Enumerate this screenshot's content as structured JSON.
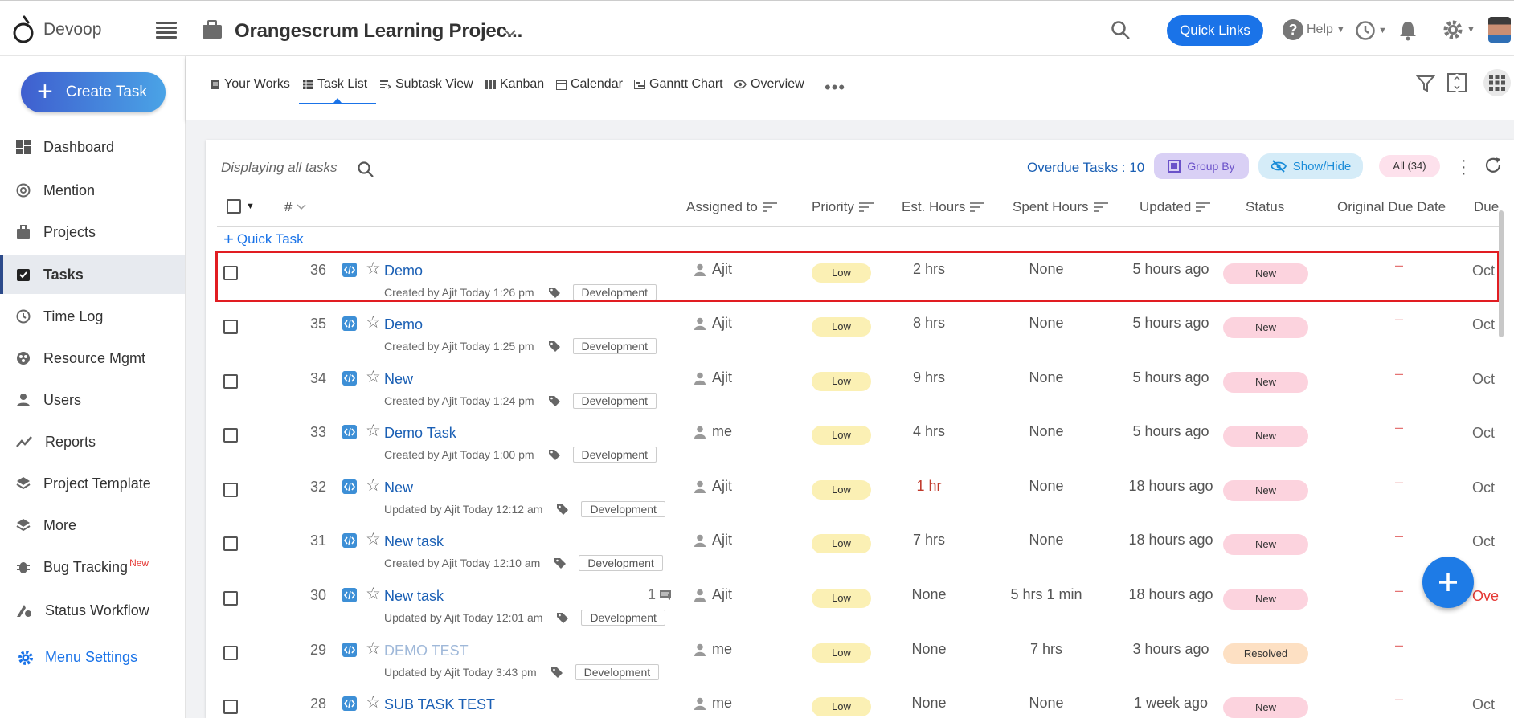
{
  "topbar": {
    "brand": "Devoop",
    "project_title": "Orangescrum Learning Projec...",
    "quick_links": "Quick Links",
    "help": "Help"
  },
  "sidebar": {
    "create_task": "Create Task",
    "items": [
      {
        "label": "Dashboard",
        "icon": "dashboard-icon"
      },
      {
        "label": "Mention",
        "icon": "at-icon"
      },
      {
        "label": "Projects",
        "icon": "briefcase-icon"
      },
      {
        "label": "Tasks",
        "icon": "task-check-icon",
        "active": true
      },
      {
        "label": "Time Log",
        "icon": "clock-icon"
      },
      {
        "label": "Resource Mgmt",
        "icon": "resource-icon"
      },
      {
        "label": "Users",
        "icon": "user-icon"
      },
      {
        "label": "Reports",
        "icon": "chart-line-icon"
      },
      {
        "label": "Project Template",
        "icon": "layers-icon"
      },
      {
        "label": "More",
        "icon": "layers-icon"
      },
      {
        "label": "Bug Tracking",
        "icon": "bug-icon",
        "badge": "New"
      },
      {
        "label": "Status Workflow",
        "icon": "workflow-icon"
      }
    ],
    "menu_settings": "Menu Settings"
  },
  "tabs": [
    {
      "label": "Your Works",
      "icon": "doc-icon"
    },
    {
      "label": "Task List",
      "icon": "list-icon",
      "active": true
    },
    {
      "label": "Subtask View",
      "icon": "subtask-icon"
    },
    {
      "label": "Kanban",
      "icon": "kanban-icon"
    },
    {
      "label": "Calendar",
      "icon": "calendar-icon"
    },
    {
      "label": "Ganntt Chart",
      "icon": "gantt-icon"
    },
    {
      "label": "Overview",
      "icon": "eye-icon"
    }
  ],
  "toolbar": {
    "displaying": "Displaying all tasks",
    "overdue": "Overdue Tasks : 10",
    "group_by": "Group By",
    "show_hide": "Show/Hide",
    "all_count": "All (34)",
    "quick_task": "Quick Task"
  },
  "columns": {
    "num": "#",
    "assigned": "Assigned to",
    "priority": "Priority",
    "est": "Est. Hours",
    "spent": "Spent Hours",
    "updated": "Updated",
    "status": "Status",
    "orig_due": "Original Due Date",
    "due": "Due"
  },
  "rows": [
    {
      "num": "36",
      "title": "Demo",
      "meta": "Created by Ajit Today 1:26 pm",
      "tag": "Development",
      "assignee": "Ajit",
      "priority": "Low",
      "est": "2 hrs",
      "spent": "None",
      "updated": "5 hours ago",
      "status": "New",
      "orig_due": "–",
      "due": "Oct"
    },
    {
      "num": "35",
      "title": "Demo",
      "meta": "Created by Ajit Today 1:25 pm",
      "tag": "Development",
      "assignee": "Ajit",
      "priority": "Low",
      "est": "8 hrs",
      "spent": "None",
      "updated": "5 hours ago",
      "status": "New",
      "orig_due": "–",
      "due": "Oct"
    },
    {
      "num": "34",
      "title": "New",
      "meta": "Created by Ajit Today 1:24 pm",
      "tag": "Development",
      "assignee": "Ajit",
      "priority": "Low",
      "est": "9 hrs",
      "spent": "None",
      "updated": "5 hours ago",
      "status": "New",
      "orig_due": "–",
      "due": "Oct"
    },
    {
      "num": "33",
      "title": "Demo Task",
      "meta": "Created by Ajit Today 1:00 pm",
      "tag": "Development",
      "assignee": "me",
      "priority": "Low",
      "est": "4 hrs",
      "spent": "None",
      "updated": "5 hours ago",
      "status": "New",
      "orig_due": "–",
      "due": "Oct"
    },
    {
      "num": "32",
      "title": "New",
      "meta": "Updated by Ajit Today 12:12 am",
      "tag": "Development",
      "assignee": "Ajit",
      "priority": "Low",
      "est": "1 hr",
      "spent": "None",
      "updated": "18 hours ago",
      "status": "New",
      "orig_due": "–",
      "due": "Oct"
    },
    {
      "num": "31",
      "title": "New task",
      "meta": "Created by Ajit Today 12:10 am",
      "tag": "Development",
      "assignee": "Ajit",
      "priority": "Low",
      "est": "7 hrs",
      "spent": "None",
      "updated": "18 hours ago",
      "status": "New",
      "orig_due": "–",
      "due": "Oct"
    },
    {
      "num": "30",
      "title": "New task",
      "meta": "Updated by Ajit Today 12:01 am",
      "tag": "Development",
      "assignee": "Ajit",
      "priority": "Low",
      "est": "None",
      "spent": "5 hrs 1 min",
      "updated": "18 hours ago",
      "status": "New",
      "orig_due": "–",
      "due": "Ove",
      "comments": "1"
    },
    {
      "num": "29",
      "title": "DEMO TEST",
      "meta": "Updated by Ajit Today 3:43 pm",
      "tag": "Development",
      "assignee": "me",
      "priority": "Low",
      "est": "None",
      "spent": "7 hrs",
      "updated": "3 hours ago",
      "status": "Resolved",
      "orig_due": "–",
      "due": ""
    },
    {
      "num": "28",
      "title": "SUB TASK TEST",
      "meta": "",
      "tag": "",
      "assignee": "me",
      "priority": "Low",
      "est": "None",
      "spent": "None",
      "updated": "1 week ago",
      "status": "New",
      "orig_due": "–",
      "due": "Oct"
    }
  ]
}
